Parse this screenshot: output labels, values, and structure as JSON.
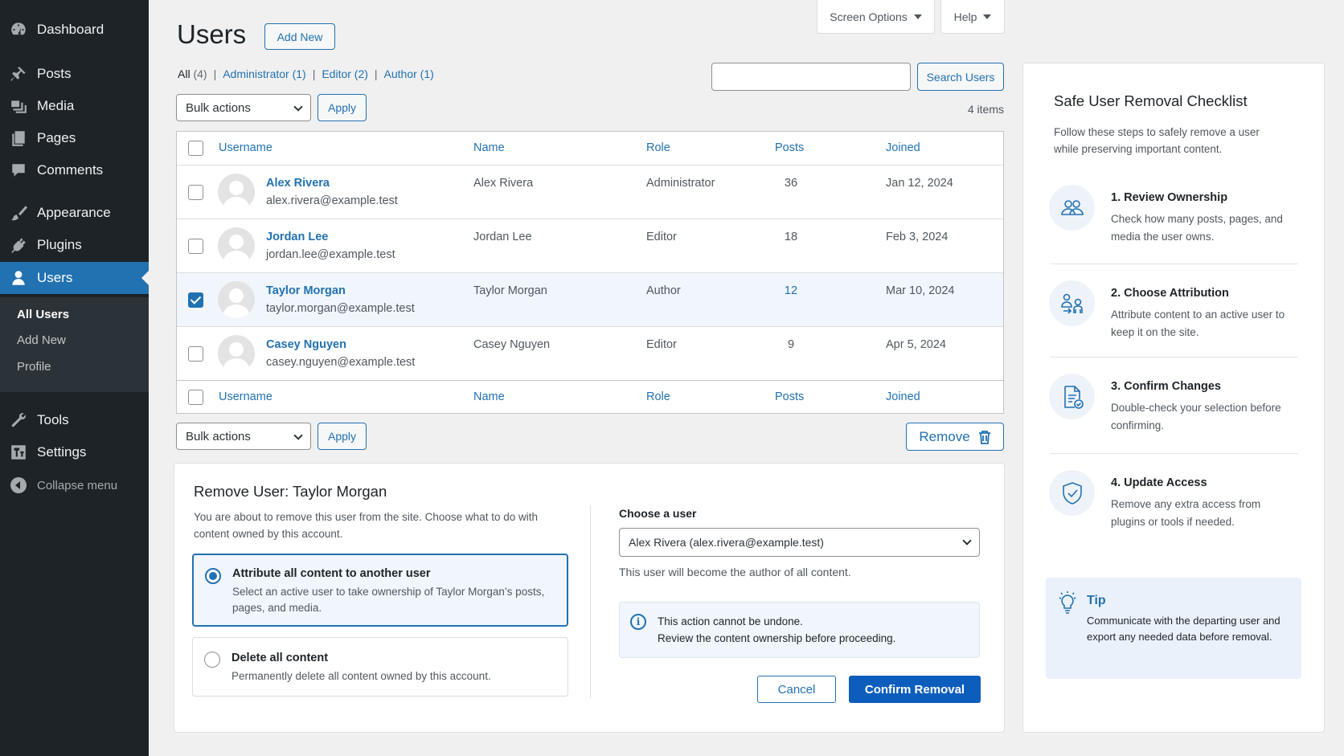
{
  "sidebar": {
    "items": [
      {
        "label": "Dashboard",
        "icon": "dashboard-icon"
      },
      {
        "label": "Posts",
        "icon": "pin-icon"
      },
      {
        "label": "Media",
        "icon": "media-icon"
      },
      {
        "label": "Pages",
        "icon": "pages-icon"
      },
      {
        "label": "Comments",
        "icon": "comment-icon"
      },
      {
        "label": "Appearance",
        "icon": "brush-icon"
      },
      {
        "label": "Plugins",
        "icon": "plug-icon"
      },
      {
        "label": "Users",
        "icon": "user-icon"
      },
      {
        "label": "Tools",
        "icon": "wrench-icon"
      },
      {
        "label": "Settings",
        "icon": "settings-icon"
      }
    ],
    "submenu": [
      "All Users",
      "Add New",
      "Profile"
    ],
    "collapse": "Collapse menu"
  },
  "top": {
    "screen_options": "Screen Options",
    "help": "Help"
  },
  "header": {
    "title": "Users",
    "add_new": "Add New"
  },
  "filters": {
    "all": "All",
    "all_count": "(4)",
    "administrator": "Administrator (1)",
    "editor": "Editor (2)",
    "author": "Author (1)"
  },
  "search": {
    "value": "",
    "button": "Search Users"
  },
  "bulk": {
    "label": "Bulk actions",
    "apply": "Apply"
  },
  "items_count": "4 items",
  "table": {
    "columns": {
      "username": "Username",
      "name": "Name",
      "role": "Role",
      "posts": "Posts",
      "joined": "Joined"
    },
    "rows": [
      {
        "username": "Alex Rivera",
        "email": "alex.rivera@example.test",
        "name": "Alex Rivera",
        "role": "Administrator",
        "posts": "36",
        "joined": "Jan 12, 2024",
        "checked": false
      },
      {
        "username": "Jordan Lee",
        "email": "jordan.lee@example.test",
        "name": "Jordan Lee",
        "role": "Editor",
        "posts": "18",
        "joined": "Feb 3, 2024",
        "checked": false
      },
      {
        "username": "Taylor Morgan",
        "email": "taylor.morgan@example.test",
        "name": "Taylor Morgan",
        "role": "Author",
        "posts": "12",
        "joined": "Mar 10, 2024",
        "checked": true
      },
      {
        "username": "Casey Nguyen",
        "email": "casey.nguyen@example.test",
        "name": "Casey Nguyen",
        "role": "Editor",
        "posts": "9",
        "joined": "Apr 5, 2024",
        "checked": false
      }
    ]
  },
  "remove_button": "Remove",
  "remove_panel": {
    "title": "Remove User: Taylor Morgan",
    "description": "You are about to remove this user from the site. Choose what to do with content owned by this account.",
    "options": [
      {
        "title": "Attribute all content to another user",
        "desc": "Select an active user to take ownership of Taylor Morgan’s posts, pages, and media.",
        "selected": true
      },
      {
        "title": "Delete all content",
        "desc": "Permanently delete all content owned by this account.",
        "selected": false
      }
    ],
    "choose_label": "Choose a user",
    "choose_value": "Alex Rivera (alex.rivera@example.test)",
    "choose_help": "This user will become the author of all content.",
    "notice_line1": "This action cannot be undone.",
    "notice_line2": "Review the content ownership before proceeding.",
    "cancel": "Cancel",
    "confirm": "Confirm Removal"
  },
  "checklist": {
    "title": "Safe User Removal Checklist",
    "intro": "Follow these steps to safely remove a user while preserving important content.",
    "steps": [
      {
        "title": "1. Review Ownership",
        "desc": "Check how many posts, pages, and media the user owns.",
        "icon": "users-icon"
      },
      {
        "title": "2. Choose Attribution",
        "desc": "Attribute content to an active user to keep it on the site.",
        "icon": "transfer-users-icon"
      },
      {
        "title": "3. Confirm Changes",
        "desc": "Double-check your selection before confirming.",
        "icon": "document-check-icon"
      },
      {
        "title": "4. Update Access",
        "desc": "Remove any extra access from plugins or tools if needed.",
        "icon": "shield-check-icon"
      }
    ],
    "tip_title": "Tip",
    "tip_text": "Communicate with the departing user and export any needed data before removal."
  },
  "colors": {
    "accent": "#2271b1",
    "sidebar": "#1d2327",
    "confirm": "#0d5ebc"
  }
}
